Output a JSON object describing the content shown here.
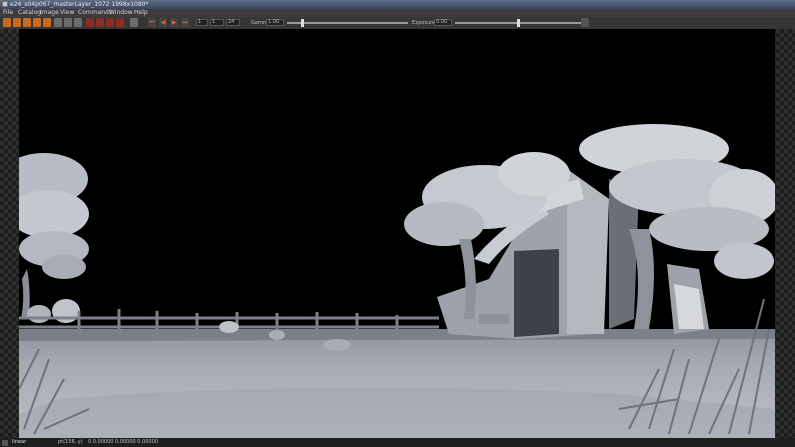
{
  "window": {
    "title": "e24_s04p067_masterLayer_1072 1998x1080*"
  },
  "menu": {
    "items": [
      "File",
      "Catalog",
      "Image",
      "View",
      "Commands",
      "Window",
      "Help"
    ]
  },
  "toolbar": {
    "frame_start": "1",
    "frame_current": "1",
    "frame_end": "24",
    "gamma_label": "Gamma",
    "gamma_value": "1.00",
    "exposure_label": "Exposure",
    "exposure_value": "0.00"
  },
  "statusbar": {
    "view_mode": "linear",
    "pixel_label": "pt(156, y)",
    "pixel_values": "0  0.00000  0.00000  0.00000"
  },
  "colors": {
    "accent": "#c86a1e",
    "background": "#2b2b2b"
  }
}
